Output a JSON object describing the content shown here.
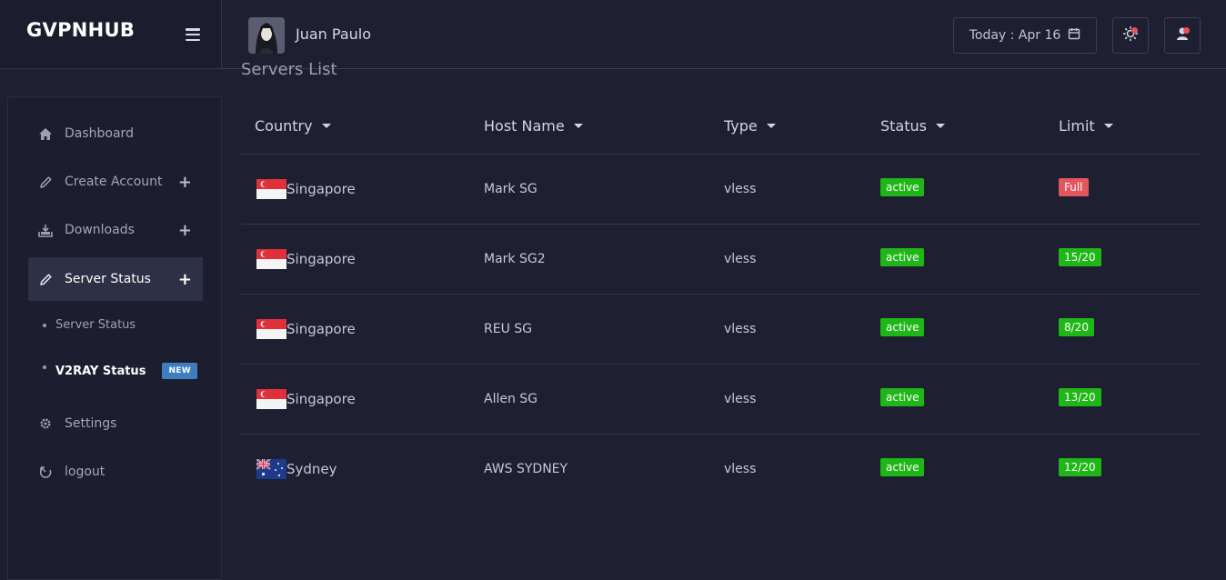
{
  "brand": "GVPNHUB",
  "user": {
    "name": "Juan Paulo"
  },
  "header": {
    "date_label": "Today : Apr 16"
  },
  "sidebar": {
    "items": [
      {
        "label": "Dashboard",
        "icon": "home-icon"
      },
      {
        "label": "Create Account",
        "icon": "pencil-icon"
      },
      {
        "label": "Downloads",
        "icon": "download-icon"
      },
      {
        "label": "Server Status",
        "icon": "pencil-icon"
      }
    ],
    "subitems": [
      {
        "label": "Server Status"
      },
      {
        "label": "V2RAY Status",
        "badge": "NEW"
      }
    ],
    "bottom": [
      {
        "label": "Settings",
        "icon": "gear-icon"
      },
      {
        "label": "logout",
        "icon": "logout-icon"
      }
    ]
  },
  "page": {
    "title": "Servers List"
  },
  "table": {
    "columns": [
      "Country",
      "Host Name",
      "Type",
      "Status",
      "Limit"
    ],
    "rows": [
      {
        "country": "Singapore",
        "flag": "singapore-flag-icon",
        "host": "Mark SG",
        "type": "vless",
        "status": "active",
        "limit": "Full",
        "limit_color": "#e2565c"
      },
      {
        "country": "Singapore",
        "flag": "singapore-flag-icon",
        "host": "Mark SG2",
        "type": "vless",
        "status": "active",
        "limit": "15/20",
        "limit_color": "#1fb718"
      },
      {
        "country": "Singapore",
        "flag": "singapore-flag-icon",
        "host": "REU SG",
        "type": "vless",
        "status": "active",
        "limit": "8/20",
        "limit_color": "#1fb718"
      },
      {
        "country": "Singapore",
        "flag": "singapore-flag-icon",
        "host": "Allen SG",
        "type": "vless",
        "status": "active",
        "limit": "13/20",
        "limit_color": "#1fb718"
      },
      {
        "country": "Sydney",
        "flag": "australia-flag-icon",
        "host": "AWS SYDNEY",
        "type": "vless",
        "status": "active",
        "limit": "12/20",
        "limit_color": "#1fb718"
      }
    ]
  },
  "colors": {
    "background": "#1e1f31",
    "sidebar": "#1c1d2e",
    "active_green": "#1fb718",
    "full_red": "#e2565c",
    "badge_blue": "#3c7ebf",
    "notification_red": "#ee4d5f"
  }
}
